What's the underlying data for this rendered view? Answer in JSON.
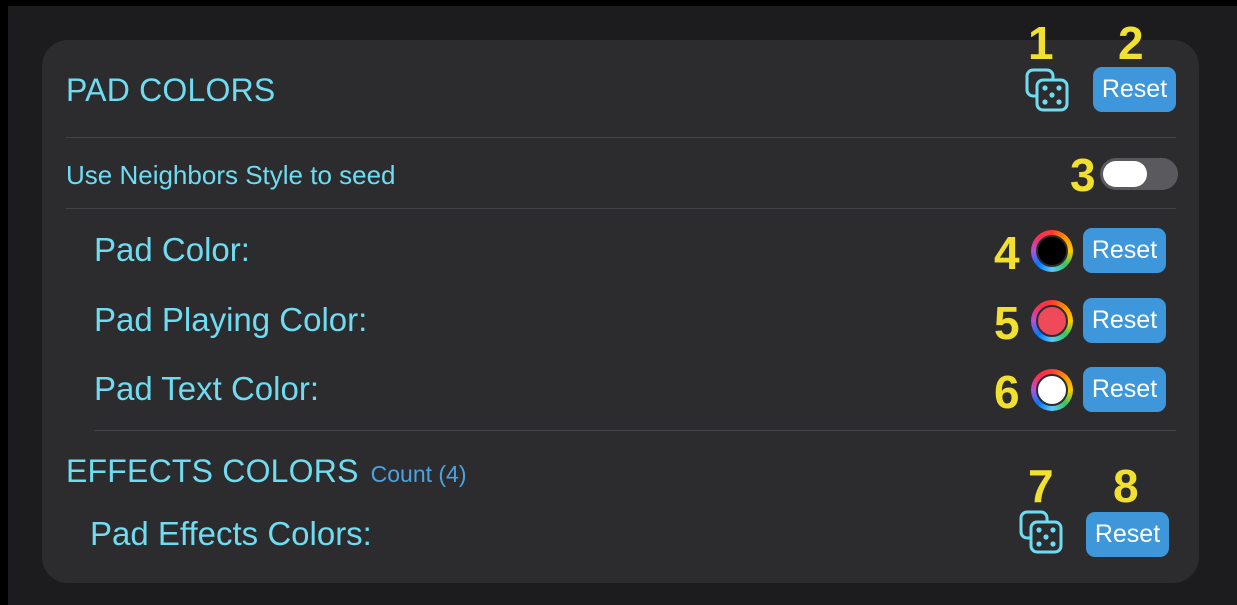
{
  "pad_colors": {
    "title": "PAD COLORS",
    "reset_label": "Reset",
    "neighbors_label": "Use Neighbors Style to seed",
    "neighbors_toggle_on": false,
    "rows": [
      {
        "label": "Pad Color:",
        "color": "#000000",
        "reset_label": "Reset"
      },
      {
        "label": "Pad Playing Color:",
        "color": "#ee4a5a",
        "reset_label": "Reset"
      },
      {
        "label": "Pad Text Color:",
        "color": "#ffffff",
        "reset_label": "Reset"
      }
    ]
  },
  "effects_colors": {
    "title": "EFFECTS COLORS",
    "count": "Count (4)",
    "row_label": "Pad Effects Colors:",
    "reset_label": "Reset"
  },
  "markers": [
    "1",
    "2",
    "3",
    "4",
    "5",
    "6",
    "7",
    "8"
  ],
  "colors": {
    "accent_text": "#6fdcf2",
    "button": "#3d97da",
    "marker": "#f1e02f",
    "card": "#2c2c2e"
  }
}
